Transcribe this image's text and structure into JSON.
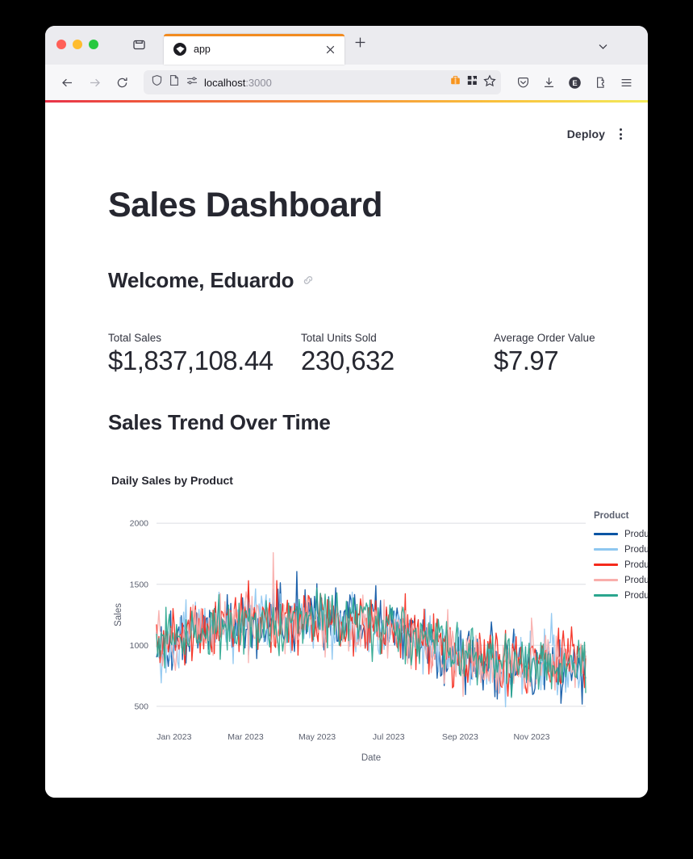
{
  "browser": {
    "traffic_lights": [
      "close",
      "minimize",
      "maximize"
    ],
    "tab": {
      "title": "app",
      "favicon_name": "streamlit-favicon",
      "close_label": "×",
      "accent_color": "#f28b20"
    },
    "new_tab_label": "+",
    "nav": {
      "back_label": "←",
      "forward_label": "→",
      "reload_label": "↻"
    },
    "url": {
      "host": "localhost",
      "port": ":3000",
      "shield_icon": "shield-icon",
      "reader_icon": "reader-view-icon",
      "tracking_icon": "tracking-protection-icon"
    },
    "url_right_icons": [
      "container-tab-icon",
      "app-grid-icon",
      "bookmark-star-icon"
    ],
    "toolbar_right_icons": [
      "pocket-icon",
      "downloads-icon",
      "account-icon",
      "extensions-icon",
      "menu-icon"
    ],
    "account_badge": "E",
    "load_bar_colors": [
      "#e8334a",
      "#ef5b3c",
      "#f5913a",
      "#f9c13c",
      "#f3ea5a"
    ]
  },
  "app": {
    "deploy_label": "Deploy",
    "menu_icon": "kebab-menu-icon",
    "title": "Sales Dashboard",
    "welcome_heading": "Welcome, Eduardo",
    "anchor_icon": "link-icon",
    "metrics": [
      {
        "label": "Total Sales",
        "value": "$1,837,108.44"
      },
      {
        "label": "Total Units Sold",
        "value": "230,632"
      },
      {
        "label": "Average Order Value",
        "value": "$7.97"
      }
    ],
    "trend_heading": "Sales Trend Over Time"
  },
  "chart_data": {
    "type": "line",
    "title": "Daily Sales by Product",
    "xlabel": "Date",
    "ylabel": "Sales",
    "xlim": [
      "2023-01-01",
      "2023-12-31"
    ],
    "ylim": [
      400,
      2100
    ],
    "y_ticks": [
      500,
      1000,
      1500,
      2000
    ],
    "x_ticks": [
      "Jan 2023",
      "Mar 2023",
      "May 2023",
      "Jul 2023",
      "Sep 2023",
      "Nov 2023"
    ],
    "grid": true,
    "legend": {
      "title": "Product",
      "position": "right"
    },
    "n_points_per_series": 365,
    "noise_amplitude": 320,
    "series": [
      {
        "name": "Product A",
        "color": "#0b55a4",
        "baseline": [
          980,
          1120,
          1180,
          1200,
          1210,
          1180,
          1140,
          1010,
          890,
          840,
          850,
          880
        ]
      },
      {
        "name": "Product B",
        "color": "#8ec7f0",
        "baseline": [
          960,
          1100,
          1165,
          1195,
          1200,
          1170,
          1120,
          1000,
          880,
          830,
          845,
          875
        ]
      },
      {
        "name": "Product C",
        "color": "#f52a1c",
        "baseline": [
          1000,
          1140,
          1200,
          1220,
          1225,
          1190,
          1150,
          1020,
          900,
          850,
          860,
          890
        ]
      },
      {
        "name": "Product D",
        "color": "#f9aeab",
        "baseline": [
          975,
          1110,
          1175,
          1205,
          1215,
          1175,
          1130,
          1005,
          885,
          835,
          848,
          878
        ]
      },
      {
        "name": "Product E",
        "color": "#2ba68e",
        "baseline": [
          990,
          1130,
          1190,
          1210,
          1218,
          1185,
          1145,
          1015,
          895,
          845,
          855,
          885
        ]
      }
    ]
  }
}
